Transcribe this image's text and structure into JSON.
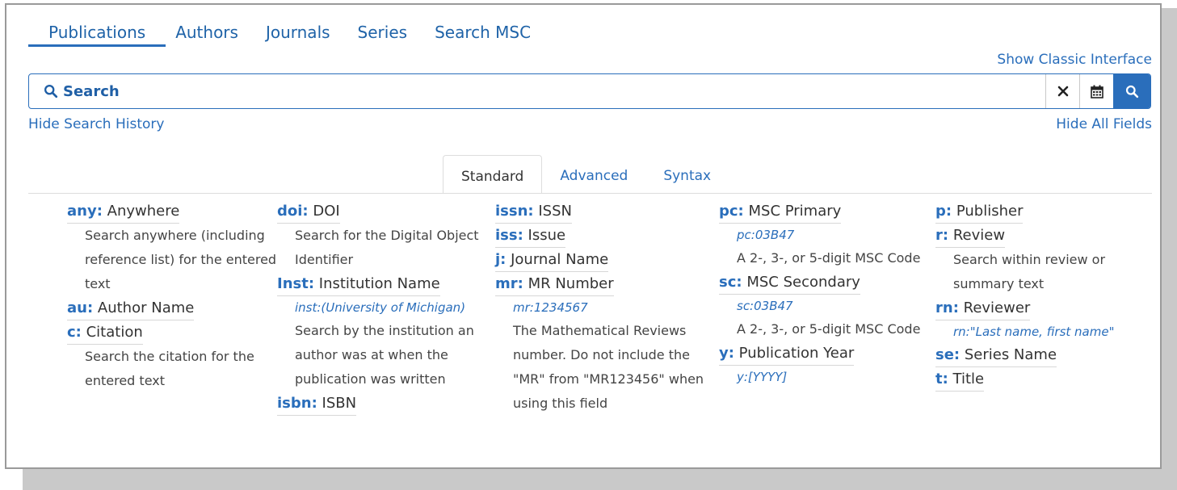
{
  "nav": {
    "items": [
      "Publications",
      "Authors",
      "Journals",
      "Series",
      "Search MSC"
    ],
    "active": "Publications"
  },
  "links": {
    "classic": "Show Classic Interface",
    "hide_history": "Hide Search History",
    "hide_fields": "Hide All Fields"
  },
  "search": {
    "placeholder": "Search",
    "value": ""
  },
  "icons": {
    "search_left": "search-icon",
    "clear": "close-icon",
    "calendar": "calendar-icon",
    "go": "search-icon"
  },
  "subtabs": [
    "Standard",
    "Advanced",
    "Syntax"
  ],
  "colors": {
    "accent": "#2a6ebb",
    "link": "#2a6ebb",
    "text": "#333333",
    "border": "#dddddd"
  },
  "fields": {
    "col1": [
      {
        "key": "any:",
        "label": "Anywhere",
        "example": "",
        "desc": "Search anywhere (including reference list) for the entered text"
      },
      {
        "key": "au:",
        "label": "Author Name",
        "example": "",
        "desc": ""
      },
      {
        "key": "c:",
        "label": "Citation",
        "example": "",
        "desc": "Search the citation for the entered text"
      }
    ],
    "col2": [
      {
        "key": "doi:",
        "label": "DOI",
        "example": "",
        "desc": "Search for the Digital Object Identifier"
      },
      {
        "key": "Inst:",
        "label": "Institution Name",
        "example": "inst:(University of Michigan)",
        "desc": "Search by the institution an author was at when the publication was written"
      },
      {
        "key": "isbn:",
        "label": "ISBN",
        "example": "",
        "desc": ""
      }
    ],
    "col3": [
      {
        "key": "issn:",
        "label": "ISSN",
        "example": "",
        "desc": ""
      },
      {
        "key": "iss:",
        "label": "Issue",
        "example": "",
        "desc": ""
      },
      {
        "key": "j:",
        "label": "Journal Name",
        "example": "",
        "desc": ""
      },
      {
        "key": "mr:",
        "label": "MR Number",
        "example": "mr:1234567",
        "desc": "The Mathematical Reviews number. Do not include the \"MR\" from \"MR123456\" when using this field"
      }
    ],
    "col4": [
      {
        "key": "pc:",
        "label": "MSC Primary",
        "example": "pc:03B47",
        "desc": "A 2-, 3-, or 5-digit MSC Code"
      },
      {
        "key": "sc:",
        "label": "MSC Secondary",
        "example": "sc:03B47",
        "desc": "A 2-, 3-, or 5-digit MSC Code"
      },
      {
        "key": "y:",
        "label": "Publication Year",
        "example": "y:[YYYY]",
        "desc": ""
      }
    ],
    "col5": [
      {
        "key": "p:",
        "label": "Publisher",
        "example": "",
        "desc": ""
      },
      {
        "key": "r:",
        "label": "Review",
        "example": "",
        "desc": "Search within review or summary text"
      },
      {
        "key": "rn:",
        "label": "Reviewer",
        "example": "rn:\"Last name, first name\"",
        "desc": ""
      },
      {
        "key": "se:",
        "label": "Series Name",
        "example": "",
        "desc": ""
      },
      {
        "key": "t:",
        "label": "Title",
        "example": "",
        "desc": ""
      }
    ]
  }
}
